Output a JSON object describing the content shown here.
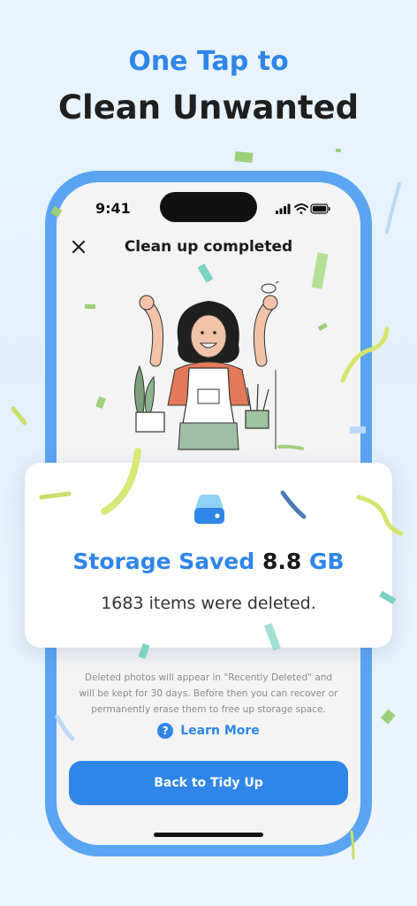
{
  "headline": {
    "line1": "One Tap to",
    "line2": "Clean Unwanted"
  },
  "status_bar": {
    "time": "9:41"
  },
  "screen": {
    "title": "Clean up completed",
    "info_text": "Deleted photos will appear in \"Recently Deleted\" and will be kept for 30 days. Before then you can recover or permanently erase them to free up storage space.",
    "learn_more_label": "Learn More",
    "back_button_label": "Back to Tidy Up"
  },
  "result_card": {
    "saved_prefix": "Storage Saved",
    "saved_amount": "8.8",
    "saved_unit": "GB",
    "items_text": "1683 items were deleted."
  },
  "colors": {
    "accent": "#2f86e8",
    "phone_frame": "#5aa5f2",
    "confetti_green": "#b9d86a"
  },
  "icons": [
    "close-icon",
    "signal-icon",
    "wifi-icon",
    "battery-icon",
    "question-icon",
    "storage-drive-icon"
  ]
}
